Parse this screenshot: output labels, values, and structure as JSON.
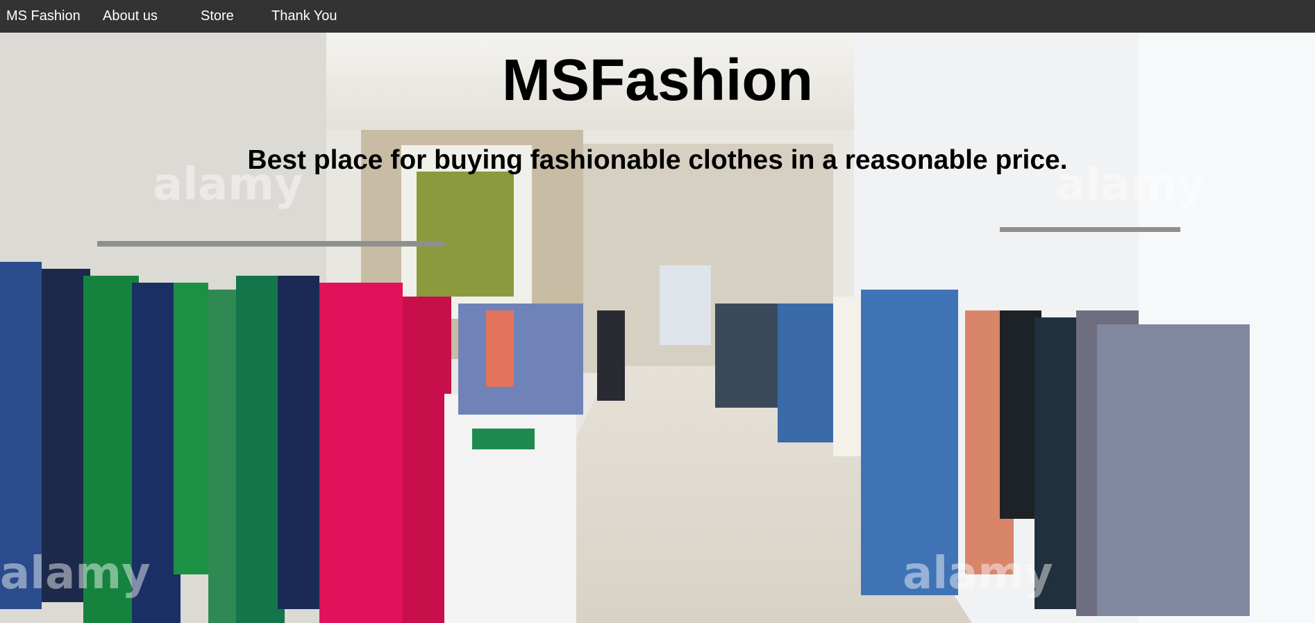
{
  "nav": {
    "brand": "MS Fashion",
    "links": [
      {
        "label": "About us"
      },
      {
        "label": "Store"
      },
      {
        "label": "Thank You"
      }
    ]
  },
  "hero": {
    "title": "MSFashion",
    "subtitle": "Best place for buying fashionable clothes in a reasonable price.",
    "watermark": "alamy"
  },
  "colors": {
    "navbar_bg": "#333333",
    "nav_text": "#ffffff",
    "hero_text": "#000000"
  }
}
